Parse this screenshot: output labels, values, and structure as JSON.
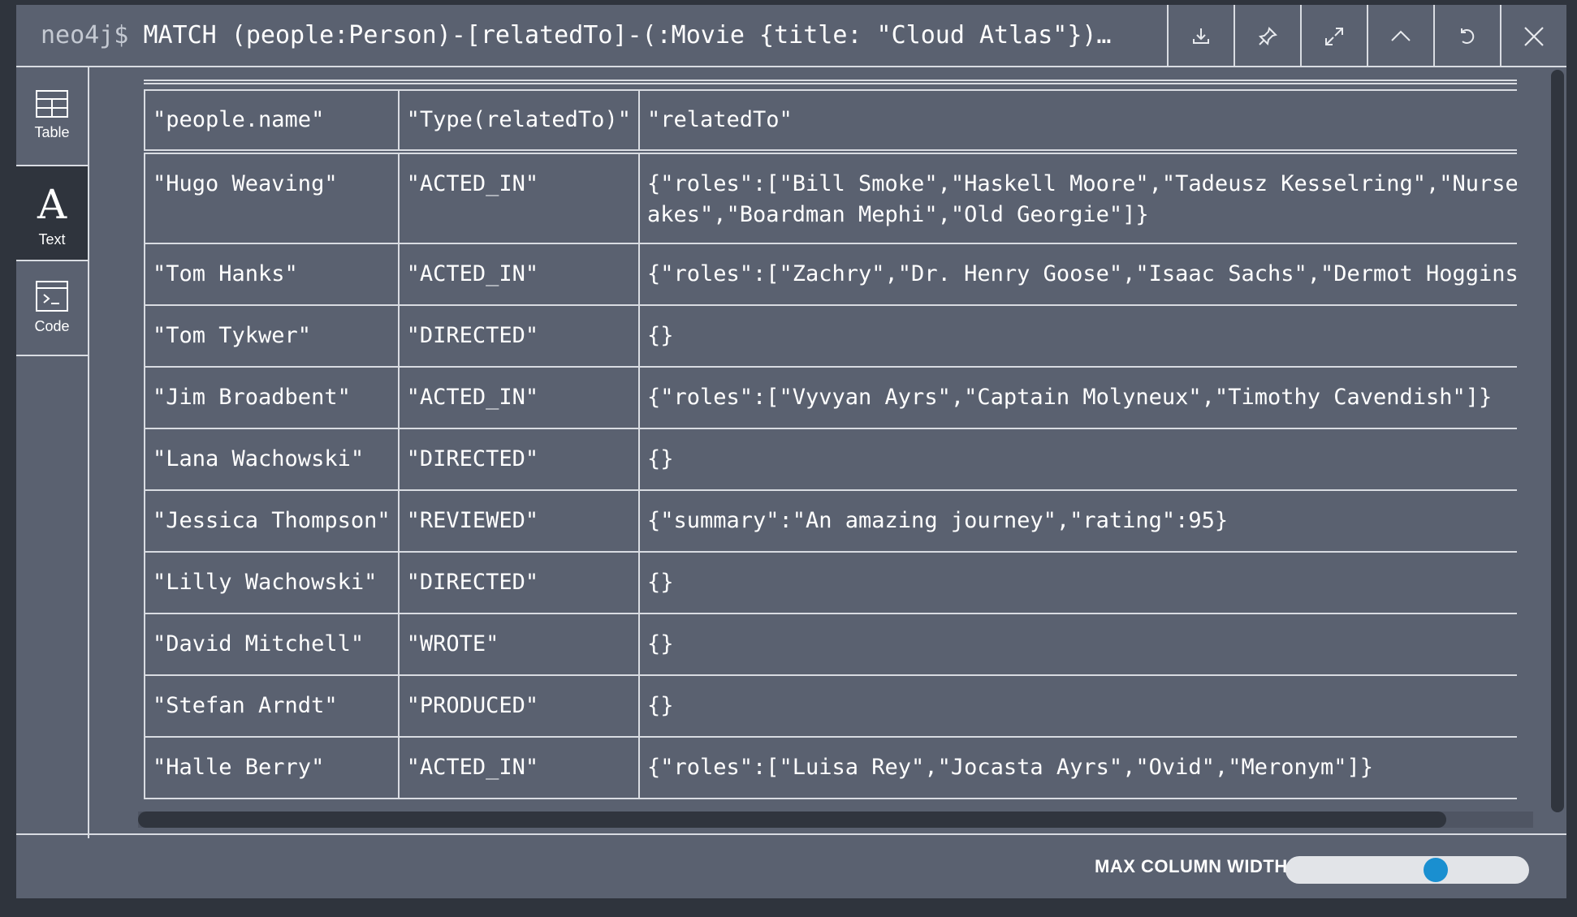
{
  "header": {
    "prompt": "neo4j$",
    "query": "MATCH (people:Person)-[relatedTo]-(:Movie {title: \"Cloud Atlas\"})…",
    "buttons": [
      {
        "name": "download-icon"
      },
      {
        "name": "pin-icon"
      },
      {
        "name": "expand-icon"
      },
      {
        "name": "collapse-up-icon"
      },
      {
        "name": "rerun-icon"
      },
      {
        "name": "close-icon"
      }
    ]
  },
  "sidebar": {
    "items": [
      {
        "label": "Table",
        "icon": "table-icon",
        "active": false
      },
      {
        "label": "Text",
        "icon": "text-icon",
        "glyph": "A",
        "active": true
      },
      {
        "label": "Code",
        "icon": "code-icon",
        "active": false
      }
    ]
  },
  "table": {
    "columns": [
      "\"people.name\"",
      "\"Type(relatedTo)\"",
      "\"relatedTo\""
    ],
    "rows": [
      [
        "\"Hugo Weaving\"",
        "\"ACTED_IN\"",
        "{\"roles\":[\"Bill Smoke\",\"Haskell Moore\",\"Tadeusz Kesselring\",\"Nurse Noakes\",\"Boardman Mephi\",\"Old Georgie\"]}"
      ],
      [
        "\"Tom Hanks\"",
        "\"ACTED_IN\"",
        "{\"roles\":[\"Zachry\",\"Dr. Henry Goose\",\"Isaac Sachs\",\"Dermot Hoggins\"]}"
      ],
      [
        "\"Tom Tykwer\"",
        "\"DIRECTED\"",
        "{}"
      ],
      [
        "\"Jim Broadbent\"",
        "\"ACTED_IN\"",
        "{\"roles\":[\"Vyvyan Ayrs\",\"Captain Molyneux\",\"Timothy Cavendish\"]}"
      ],
      [
        "\"Lana Wachowski\"",
        "\"DIRECTED\"",
        "{}"
      ],
      [
        "\"Jessica Thompson\"",
        "\"REVIEWED\"",
        "{\"summary\":\"An amazing journey\",\"rating\":95}"
      ],
      [
        "\"Lilly Wachowski\"",
        "\"DIRECTED\"",
        "{}"
      ],
      [
        "\"David Mitchell\"",
        "\"WROTE\"",
        "{}"
      ],
      [
        "\"Stefan Arndt\"",
        "\"PRODUCED\"",
        "{}"
      ],
      [
        "\"Halle Berry\"",
        "\"ACTED_IN\"",
        "{\"roles\":[\"Luisa Rey\",\"Jocasta Ayrs\",\"Ovid\",\"Meronym\"]}"
      ]
    ]
  },
  "footer": {
    "max_column_width_label": "MAX COLUMN WIDTH:",
    "slider_value": 0.63
  },
  "colors": {
    "background": "#5a6170",
    "outer": "#2f343d",
    "text": "#ffffff",
    "accent": "#1a8fd0"
  }
}
